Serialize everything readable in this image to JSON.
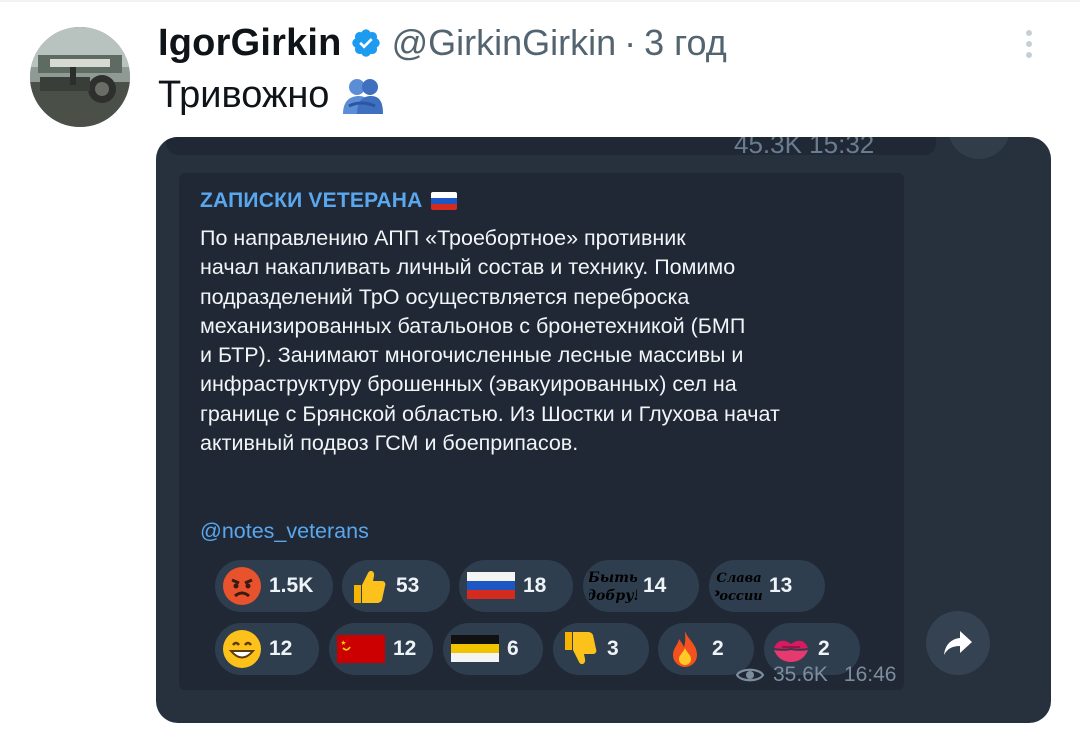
{
  "tweet": {
    "author_name": "IgorGirkin",
    "handle": "@GirkinGirkin",
    "separator": "·",
    "time_ago": "3 год",
    "text": "Тривожно",
    "verified_icon": "verified-badge-icon",
    "more_icon": "more-vertical-icon"
  },
  "telegram": {
    "previous_meta": "45.3K  15:32",
    "channel_name": "ZАПИСКИ VЕТЕРАНА",
    "message_lines": [
      "По направлению АПП «Троебортное» противник",
      "начал накапливать личный состав и технику. Помимо",
      "подразделений ТрО осуществляется переброска",
      "механизированных батальонов с бронетехникой (БМП",
      "и БТР). Занимают многочисленные лесные массивы и",
      "инфраструктуру брошенных (эвакуированных) сел на",
      "границе с Брянской областью.  Из Шостки и Глухова начат",
      "активный подвоз ГСМ и боеприпасов."
    ],
    "link": "@notes_veterans",
    "reactions": [
      {
        "icon": "angry-face-icon",
        "count": "1.5K"
      },
      {
        "icon": "thumbs-up-icon",
        "count": "53"
      },
      {
        "icon": "russia-flag-icon",
        "count": "18"
      },
      {
        "icon": "byt-dobru-sticker-icon",
        "count": "14",
        "sticker_text": "Быть добру!"
      },
      {
        "icon": "slava-rossii-sticker-icon",
        "count": "13",
        "sticker_text": "Слава России!"
      },
      {
        "icon": "grinning-face-icon",
        "count": "12"
      },
      {
        "icon": "ussr-flag-icon",
        "count": "12"
      },
      {
        "icon": "imperial-flag-icon",
        "count": "6"
      },
      {
        "icon": "thumbs-down-icon",
        "count": "3"
      },
      {
        "icon": "fire-icon",
        "count": "2"
      },
      {
        "icon": "kiss-mark-icon",
        "count": "2"
      }
    ],
    "views": "35.6K",
    "time": "16:46",
    "colors": {
      "background": "#27313d",
      "bubble": "#1f2834",
      "link": "#5aa7ee",
      "pill": "#2f3e4e"
    }
  }
}
